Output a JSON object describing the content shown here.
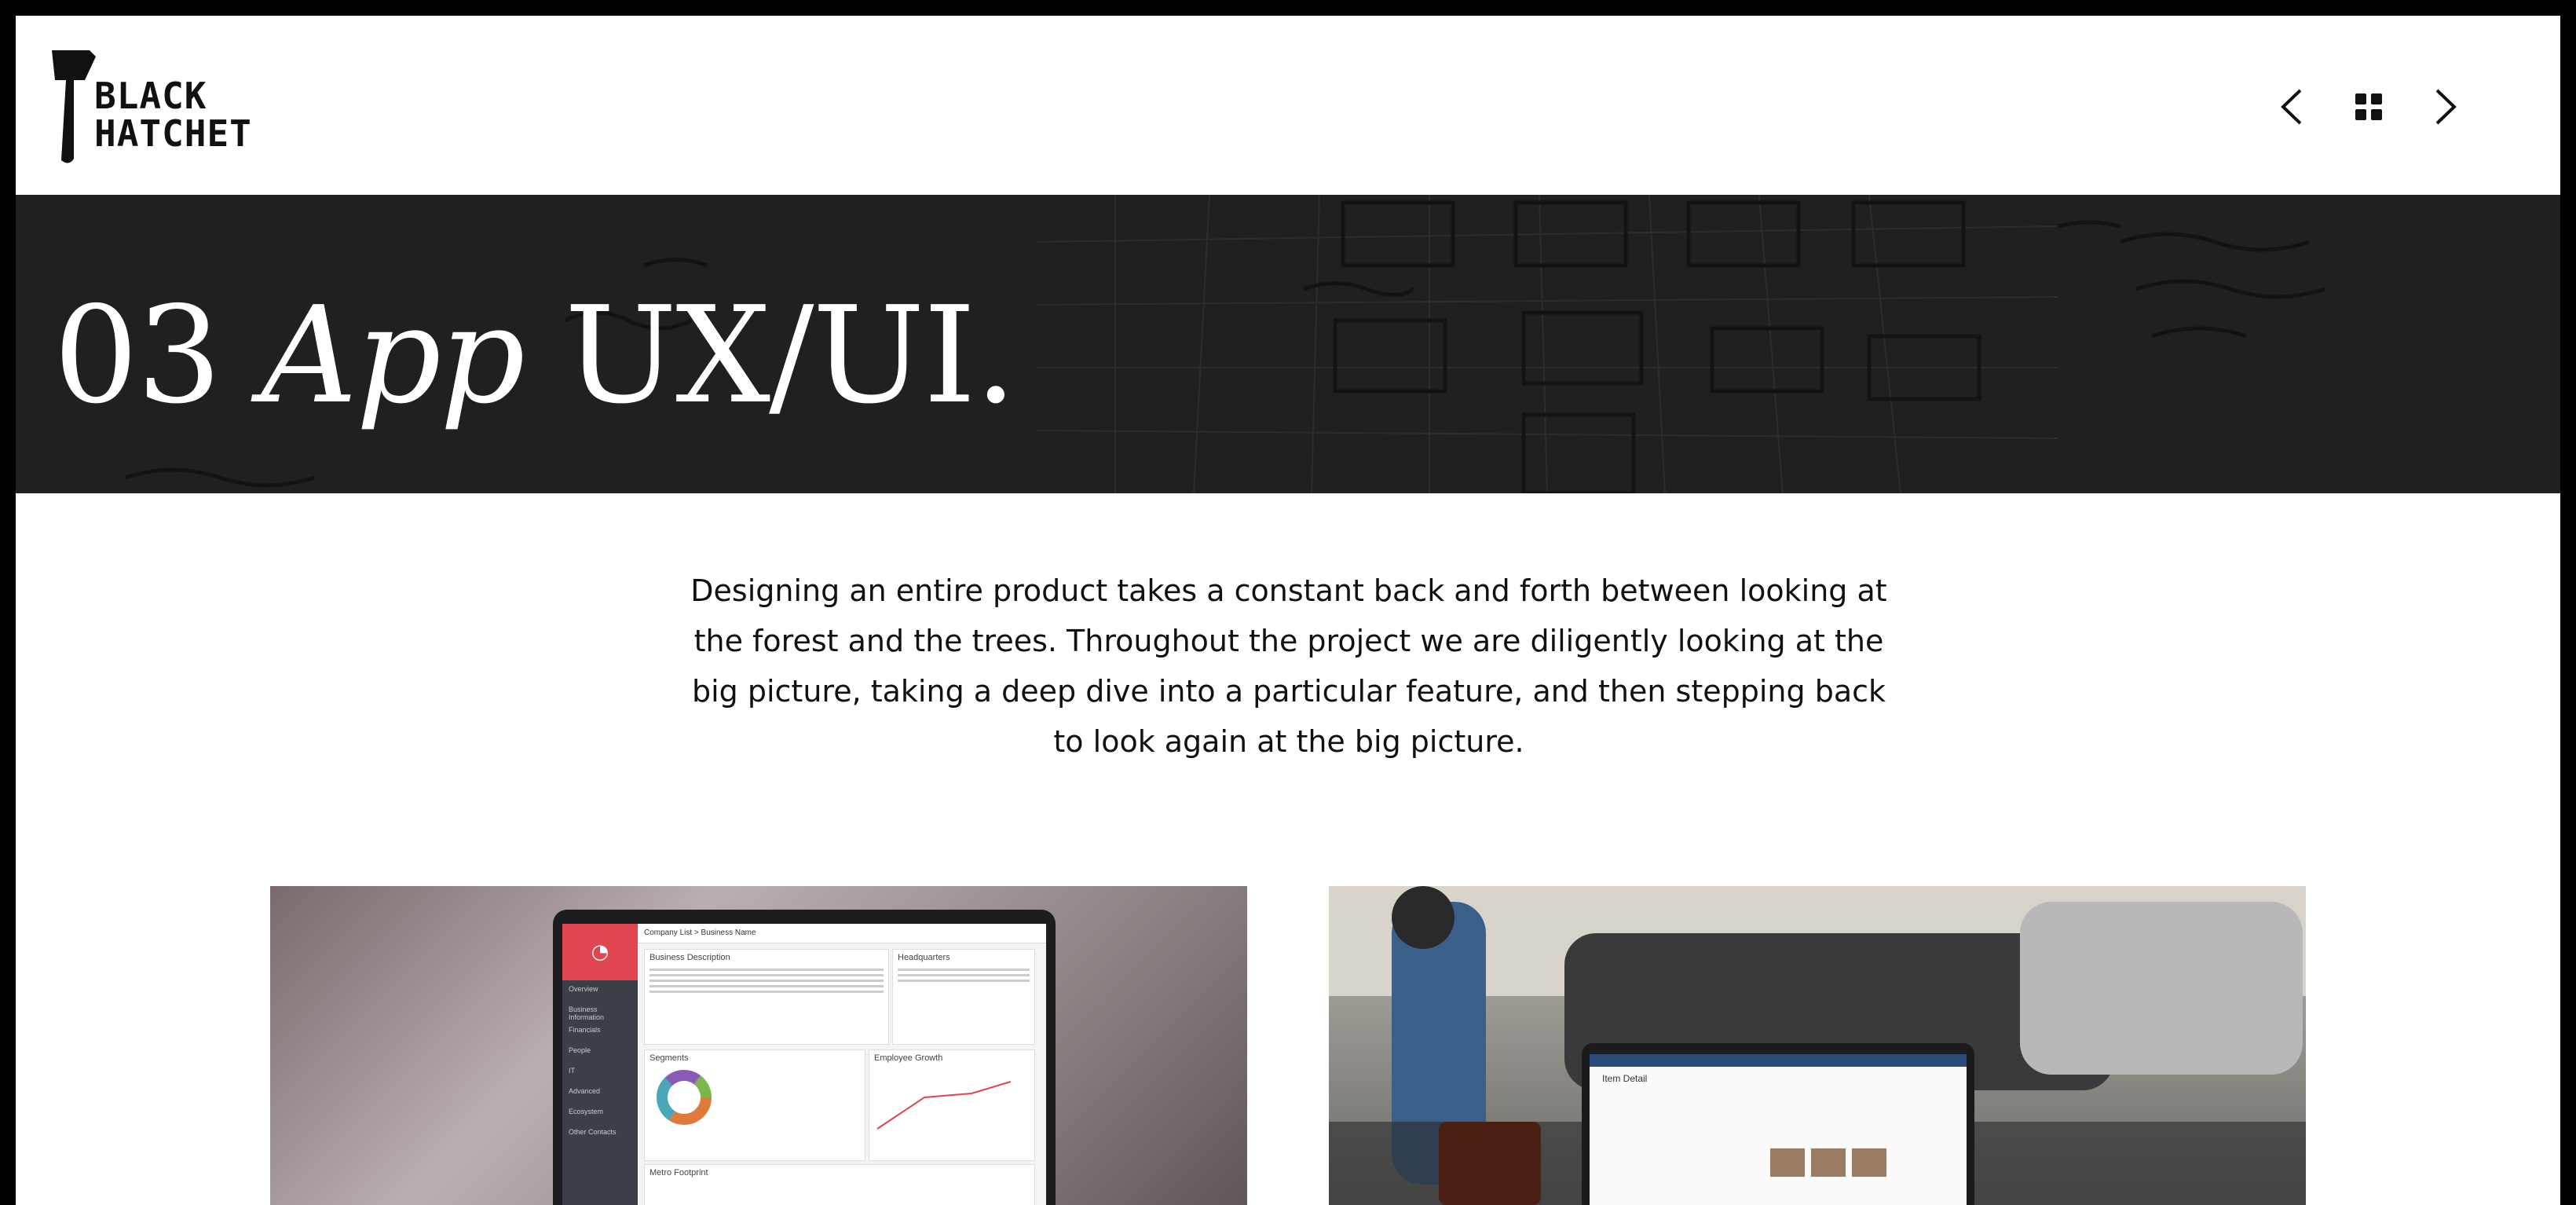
{
  "brand": {
    "line1": "BLACK",
    "line2": "HATCHET"
  },
  "nav": {
    "prev_icon": "chevron-left-icon",
    "grid_icon": "grid-icon",
    "next_icon": "chevron-right-icon"
  },
  "hero": {
    "number": "03",
    "title_italic": "App",
    "title_rest": "UX/UI."
  },
  "intro": {
    "text": "Designing an entire product takes a constant back and forth between looking at the forest and the trees. Throughout the project we are diligently looking at the big picture, taking a deep dive into a particular feature, and then stepping back to look again at the big picture."
  },
  "photo_left": {
    "breadcrumb": "Company List  >  Business Name",
    "card1": "Business Description",
    "card2": "Headquarters",
    "card3": "Segments",
    "card4": "Employee Growth",
    "card5": "Metro Footprint",
    "sidebar": [
      "Overview",
      "Business Information",
      "Financials",
      "People",
      "IT",
      "Advanced",
      "Ecosystem",
      "Other Contacts"
    ]
  },
  "photo_right": {
    "title": "Item Detail"
  },
  "colors": {
    "hero_bg": "#2b2b2b",
    "accent_red": "#e04550"
  }
}
